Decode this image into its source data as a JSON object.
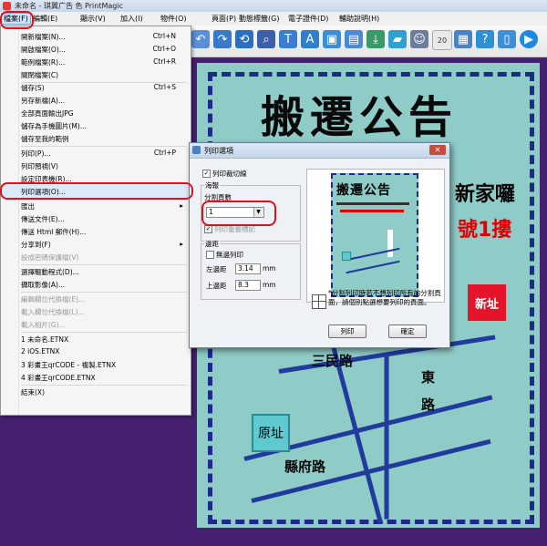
{
  "titlebar": {
    "title": "未命名 - 琪翼广告 色 PrintMagic"
  },
  "menubar": [
    "檔案(F)",
    "編輯(E)",
    "顯示(V)",
    "加入(I)",
    "物件(O)",
    "頁面(P)",
    "動態標籤(G)",
    "電子證件(D)",
    "輔助說明(H)"
  ],
  "toolbar": {
    "colors": [
      "#5a8fd6",
      "#3a78c9",
      "#2d6fbf",
      "#3b5fa8",
      "#3a7ed0",
      "#2f7fc9",
      "#3c8fd4",
      "#4a8ad6",
      "#30a0d0",
      "#3a84c8",
      "#3b9a6a",
      "#2f8fd0",
      "#6b7f9a",
      "#4a82c6",
      "#3f8fd6",
      "#1e88e5"
    ]
  },
  "file_menu": {
    "items": [
      {
        "label": "開新檔案(N)...",
        "shortcut": "Ctrl+N",
        "disabled": false
      },
      {
        "label": "開啟檔案(O)...",
        "shortcut": "Ctrl+O",
        "disabled": false
      },
      {
        "label": "範例檔案(R)...",
        "shortcut": "Ctrl+R",
        "disabled": false
      },
      {
        "label": "關閉檔案(C)",
        "shortcut": "",
        "disabled": false
      },
      {
        "label": "儲存(S)",
        "shortcut": "Ctrl+S",
        "disabled": false
      },
      {
        "label": "另存新檔(A)...",
        "shortcut": "",
        "disabled": false
      },
      {
        "label": "全部頁面輸出JPG",
        "shortcut": "",
        "disabled": false
      },
      {
        "label": "儲存為手機圖片(M)...",
        "shortcut": "",
        "disabled": false
      },
      {
        "label": "儲存至我的範例",
        "shortcut": "",
        "disabled": false
      },
      {
        "label": "列印(P)...",
        "shortcut": "Ctrl+P",
        "disabled": false
      },
      {
        "label": "列印預視(V)",
        "shortcut": "",
        "disabled": false
      },
      {
        "label": "設定印表機(R)...",
        "shortcut": "",
        "disabled": false
      },
      {
        "label": "列印選項(O)...",
        "shortcut": "",
        "disabled": false
      },
      {
        "label": "匯出",
        "shortcut": "",
        "disabled": false,
        "submenu": true
      },
      {
        "label": "傳送文件(E)...",
        "shortcut": "",
        "disabled": false
      },
      {
        "label": "傳送 Html 郵件(H)...",
        "shortcut": "",
        "disabled": false
      },
      {
        "label": "分享到(F)",
        "shortcut": "",
        "disabled": false,
        "submenu": true
      },
      {
        "label": "設成密碼保護檔(V)",
        "shortcut": "",
        "disabled": true
      },
      {
        "label": "選擇驅動程式(D)...",
        "shortcut": "",
        "disabled": false
      },
      {
        "label": "擷取影像(A)...",
        "shortcut": "",
        "disabled": false
      },
      {
        "label": "編輯欄位代換檔(E)...",
        "shortcut": "",
        "disabled": true
      },
      {
        "label": "載入欄位代換檔(L)...",
        "shortcut": "",
        "disabled": true
      },
      {
        "label": "載入相片(G)...",
        "shortcut": "",
        "disabled": true
      },
      {
        "label": "1 未命名.ETNX",
        "shortcut": "",
        "disabled": false
      },
      {
        "label": "2 iOS.ETNX",
        "shortcut": "",
        "disabled": false
      },
      {
        "label": "3 彩畫王qrCODE - 複製.ETNX",
        "shortcut": "",
        "disabled": false
      },
      {
        "label": "4 彩畫王qrCODE.ETNX",
        "shortcut": "",
        "disabled": false
      },
      {
        "label": "結束(X)",
        "shortcut": "",
        "disabled": false
      }
    ]
  },
  "poster": {
    "title": "搬遷公告",
    "line_black": "新家囉",
    "line_red": "號1摟",
    "red_box": "新址",
    "old_box": "原址",
    "road1": "三民路",
    "road2": "東路",
    "road3": "縣府路"
  },
  "dialog": {
    "title": "列印選項",
    "print_crop_marks": "列印裁切線",
    "poster_group": "海報",
    "split_pages_label": "分割頁數",
    "split_pages_value": "1",
    "print_overlap_marks": "列印重疊標記",
    "margin_group": "邊距",
    "no_margin": "無邊列印",
    "left_margin_label": "左邊距",
    "left_margin_value": "3.14",
    "top_margin_label": "上邊距",
    "top_margin_value": "8.3",
    "unit": "mm",
    "note": "*分割列印時若不想列印所有的分割頁面，請個別點選想要列印的頁面。",
    "print_button": "列印",
    "ok_button": "確定",
    "preview_title": "搬遷公告"
  }
}
